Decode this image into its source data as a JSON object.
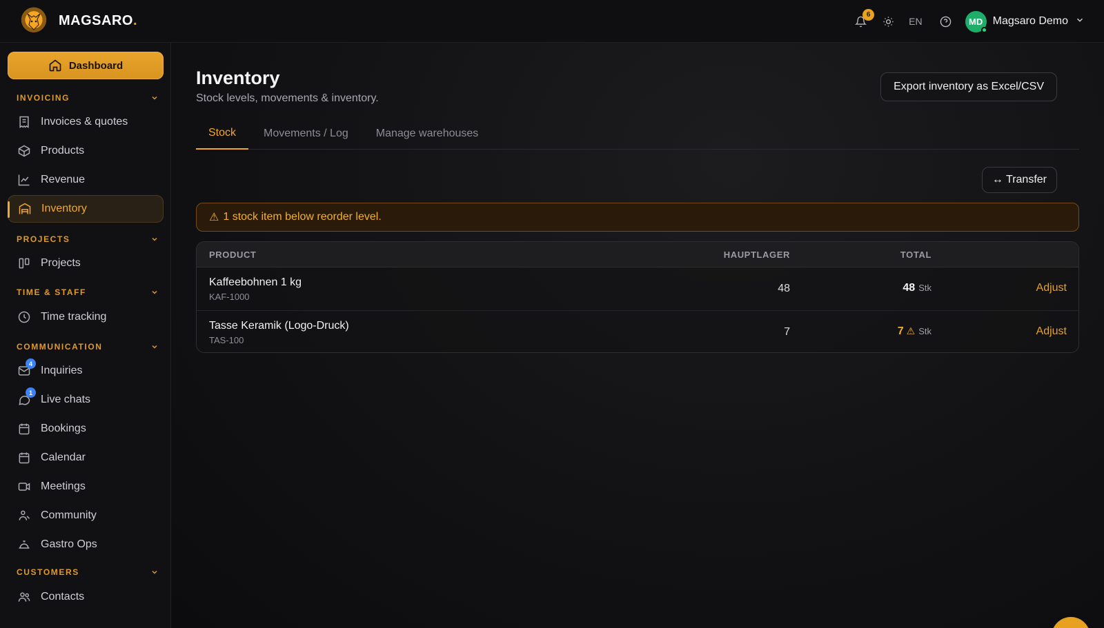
{
  "brand": {
    "name": "MAGSARO",
    "dot": "."
  },
  "topbar": {
    "notification_count": "6",
    "language": "EN",
    "user": {
      "initials": "MD",
      "name": "Magsaro Demo"
    }
  },
  "sidebar": {
    "dashboard_label": "Dashboard",
    "sections": {
      "invoicing": "INVOICING",
      "projects": "PROJECTS",
      "time_staff": "TIME & STAFF",
      "communication": "COMMUNICATION",
      "customers": "CUSTOMERS"
    },
    "items": {
      "invoices": "Invoices & quotes",
      "products": "Products",
      "revenue": "Revenue",
      "inventory": "Inventory",
      "projects": "Projects",
      "time_tracking": "Time tracking",
      "inquiries": "Inquiries",
      "inquiries_badge": "4",
      "live_chats": "Live chats",
      "live_chats_badge": "1",
      "bookings": "Bookings",
      "calendar": "Calendar",
      "meetings": "Meetings",
      "community": "Community",
      "gastro_ops": "Gastro Ops",
      "contacts": "Contacts"
    }
  },
  "main": {
    "title": "Inventory",
    "subtitle": "Stock levels, movements & inventory.",
    "export_label": "Export inventory as Excel/CSV",
    "tabs": [
      "Stock",
      "Movements / Log",
      "Manage warehouses"
    ],
    "transfer_label": "↔ Transfer",
    "alert": "1 stock item below reorder level.",
    "table": {
      "headers": {
        "product": "PRODUCT",
        "warehouse": "HAUPTLAGER",
        "total": "TOTAL"
      },
      "rows": [
        {
          "name": "Kaffeebohnen 1 kg",
          "sku": "KAF-1000",
          "warehouse": "48",
          "total": "48",
          "unit": "Stk",
          "action": "Adjust"
        },
        {
          "name": "Tasse Keramik (Logo-Druck)",
          "sku": "TAS-100",
          "warehouse": "7",
          "total": "7",
          "unit": "Stk",
          "action": "Adjust"
        }
      ]
    }
  },
  "colors": {
    "accent": "#f0a830",
    "badge_blue": "#3b82f6",
    "avatar_green": "#1fae6a"
  }
}
